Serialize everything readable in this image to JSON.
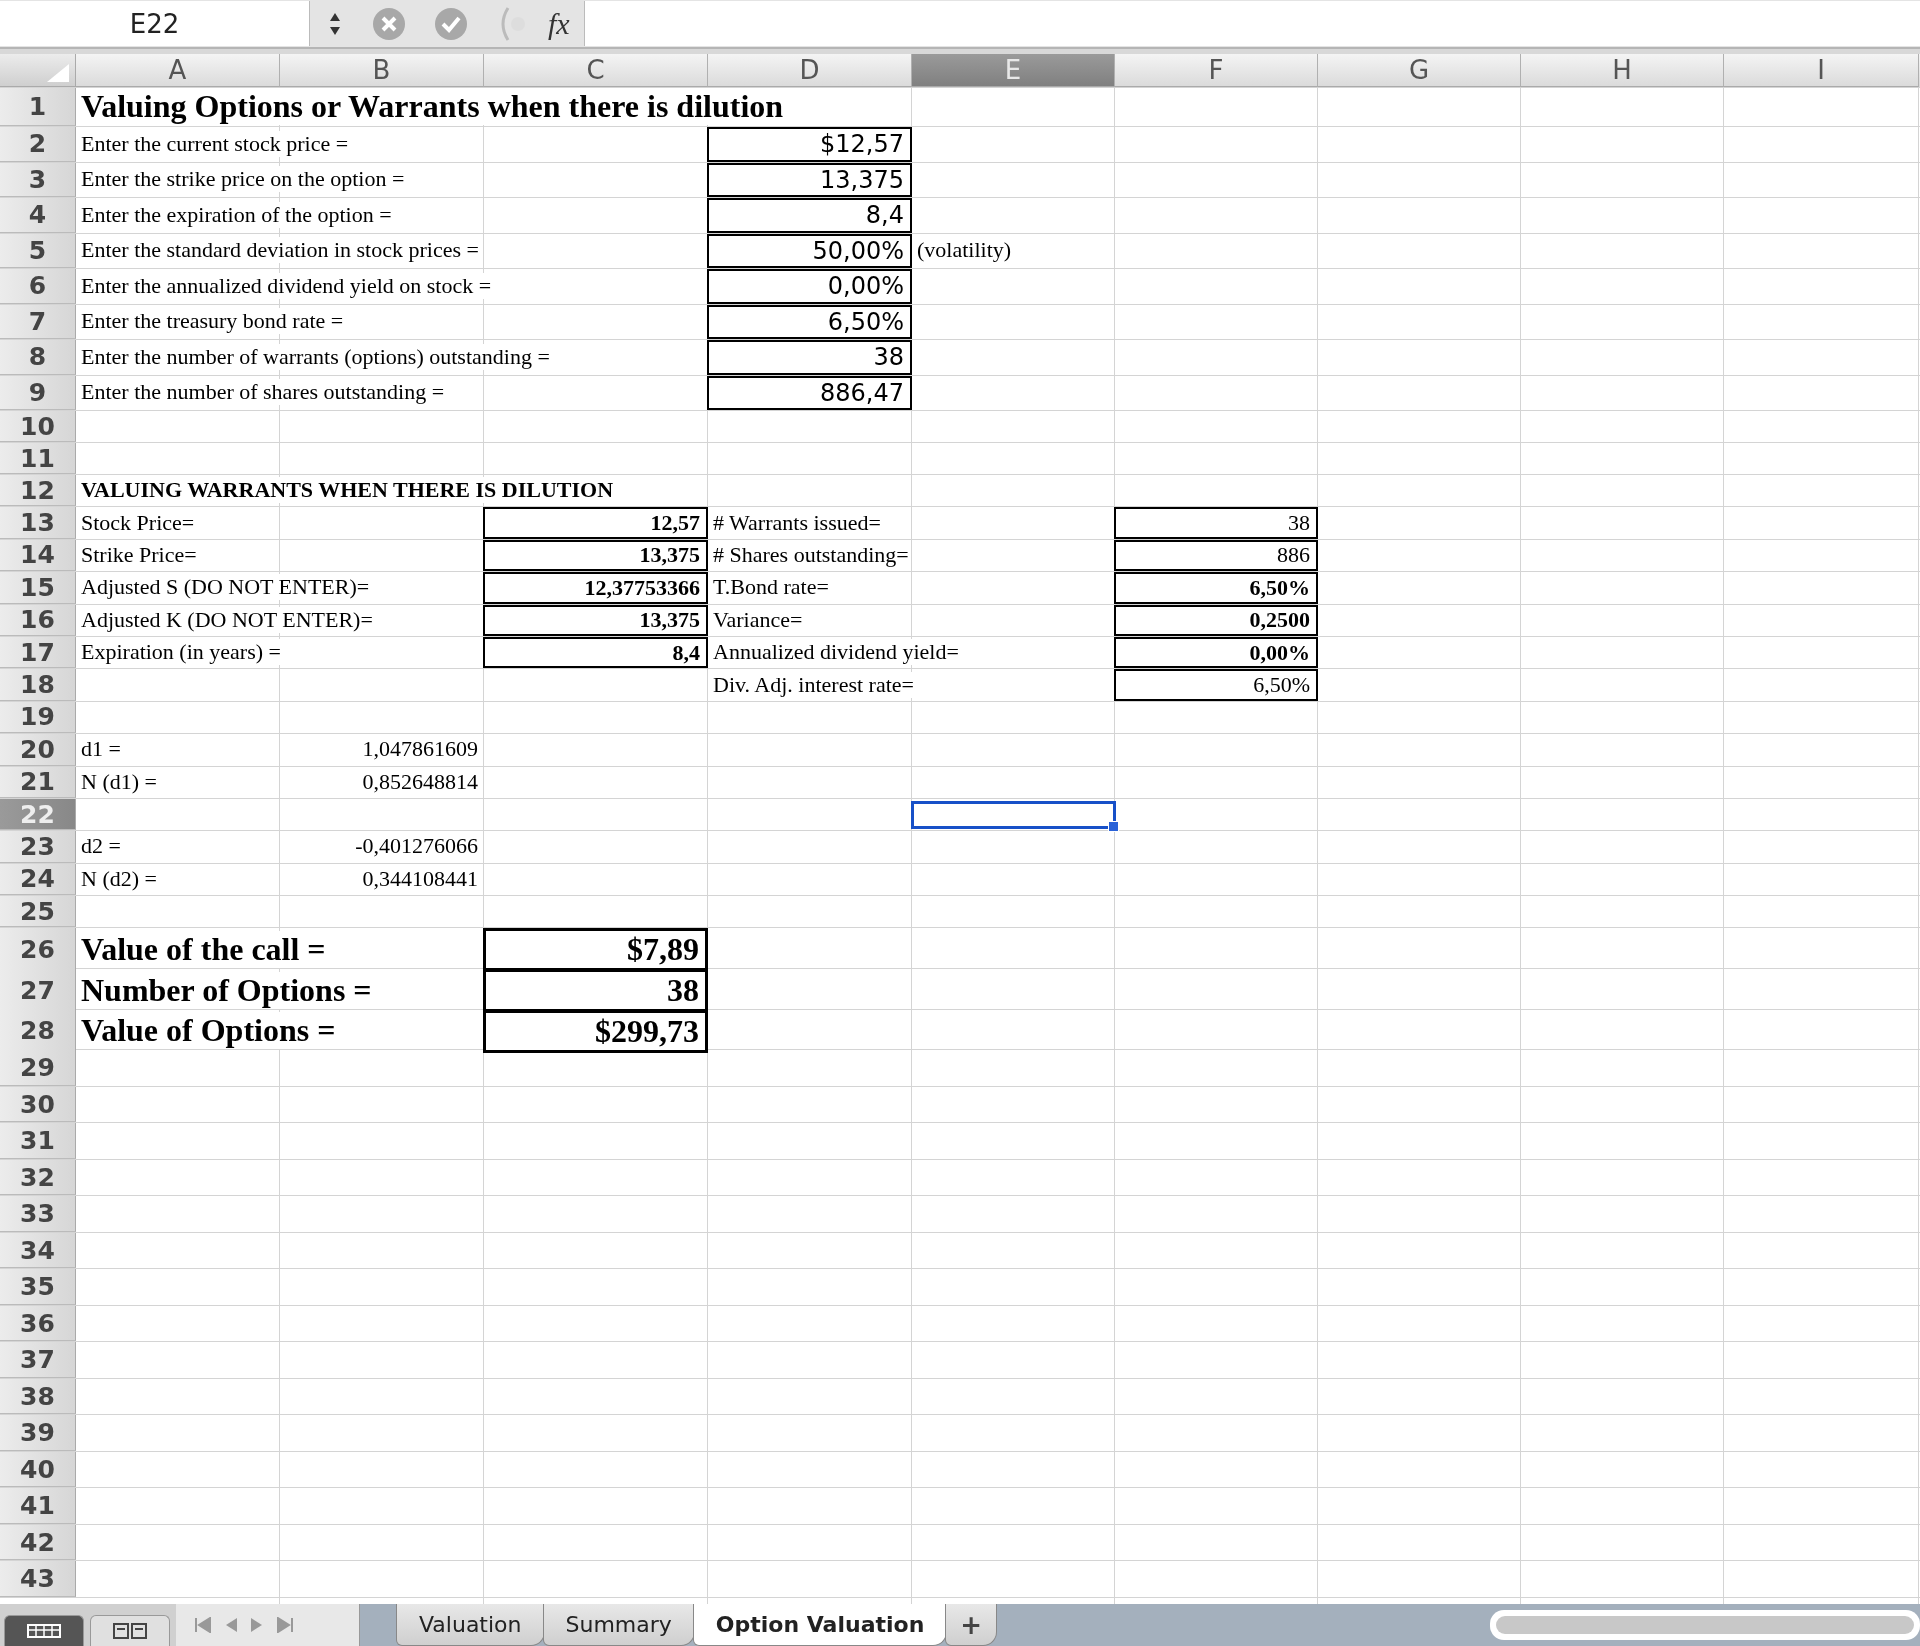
{
  "formula_bar": {
    "cell_ref": "E22",
    "function_label": "fx"
  },
  "columns": [
    {
      "label": "A",
      "selected": false
    },
    {
      "label": "B",
      "selected": false
    },
    {
      "label": "C",
      "selected": false
    },
    {
      "label": "D",
      "selected": false
    },
    {
      "label": "E",
      "selected": true
    },
    {
      "label": "F",
      "selected": false
    },
    {
      "label": "G",
      "selected": false
    },
    {
      "label": "H",
      "selected": false
    },
    {
      "label": "I",
      "selected": false
    }
  ],
  "rows": [
    {
      "number": "1",
      "selected": false,
      "cells": {
        "A": {
          "kind": "title",
          "text": "Valuing Options or Warrants when there is dilution"
        }
      }
    },
    {
      "number": "2",
      "selected": false,
      "cells": {
        "A": {
          "kind": "label",
          "text": "Enter the current stock price ="
        },
        "D": {
          "kind": "input",
          "boxed": true,
          "text": "$12,57"
        }
      }
    },
    {
      "number": "3",
      "selected": false,
      "cells": {
        "A": {
          "kind": "label",
          "text": "Enter the strike price on the option ="
        },
        "D": {
          "kind": "input",
          "boxed": true,
          "text": "13,375"
        }
      }
    },
    {
      "number": "4",
      "selected": false,
      "cells": {
        "A": {
          "kind": "label",
          "text": "Enter the expiration of the option ="
        },
        "D": {
          "kind": "input",
          "boxed": true,
          "text": "8,4"
        }
      }
    },
    {
      "number": "5",
      "selected": false,
      "cells": {
        "A": {
          "kind": "label",
          "text": "Enter the standard deviation in stock prices ="
        },
        "D": {
          "kind": "input",
          "boxed": true,
          "text": "50,00%"
        },
        "E": {
          "kind": "label",
          "text": "(volatility)"
        }
      }
    },
    {
      "number": "6",
      "selected": false,
      "cells": {
        "A": {
          "kind": "label",
          "text": "Enter the annualized dividend yield on stock ="
        },
        "D": {
          "kind": "input",
          "boxed": true,
          "text": "0,00%"
        }
      }
    },
    {
      "number": "7",
      "selected": false,
      "cells": {
        "A": {
          "kind": "label",
          "text": "Enter the treasury bond rate ="
        },
        "D": {
          "kind": "input",
          "boxed": true,
          "text": "6,50%"
        }
      }
    },
    {
      "number": "8",
      "selected": false,
      "cells": {
        "A": {
          "kind": "label",
          "text": "Enter the number of warrants (options) outstanding ="
        },
        "D": {
          "kind": "input",
          "boxed": true,
          "text": "38"
        }
      }
    },
    {
      "number": "9",
      "selected": false,
      "cells": {
        "A": {
          "kind": "label",
          "text": "Enter the number of shares outstanding ="
        },
        "D": {
          "kind": "input",
          "boxed": true,
          "text": "886,47"
        }
      }
    },
    {
      "number": "10",
      "selected": false
    },
    {
      "number": "11",
      "selected": false
    },
    {
      "number": "12",
      "selected": false,
      "cells": {
        "A": {
          "kind": "section",
          "text": "VALUING WARRANTS WHEN THERE IS DILUTION"
        }
      }
    },
    {
      "number": "13",
      "selected": false,
      "cells": {
        "A": {
          "kind": "label",
          "text": "Stock Price="
        },
        "C": {
          "kind": "value-bold",
          "boxed": true,
          "text": "12,57"
        },
        "D": {
          "kind": "label",
          "text": "# Warrants issued="
        },
        "F": {
          "kind": "value",
          "boxed": true,
          "text": "38"
        }
      }
    },
    {
      "number": "14",
      "selected": false,
      "cells": {
        "A": {
          "kind": "label",
          "text": "Strike Price="
        },
        "C": {
          "kind": "value-bold",
          "boxed": true,
          "text": "13,375"
        },
        "D": {
          "kind": "label",
          "text": "# Shares outstanding="
        },
        "F": {
          "kind": "value",
          "boxed": true,
          "text": "886"
        }
      }
    },
    {
      "number": "15",
      "selected": false,
      "cells": {
        "A": {
          "kind": "label",
          "text": "Adjusted S (DO NOT ENTER)="
        },
        "C": {
          "kind": "value-bold",
          "boxed": true,
          "text": "12,37753366"
        },
        "D": {
          "kind": "label",
          "text": "T.Bond rate="
        },
        "F": {
          "kind": "value-bold",
          "boxed": true,
          "text": "6,50%"
        }
      }
    },
    {
      "number": "16",
      "selected": false,
      "cells": {
        "A": {
          "kind": "label",
          "text": "Adjusted K (DO NOT ENTER)="
        },
        "C": {
          "kind": "value-bold",
          "boxed": true,
          "text": "13,375"
        },
        "D": {
          "kind": "label",
          "text": "Variance="
        },
        "F": {
          "kind": "value-bold",
          "boxed": true,
          "text": "0,2500"
        }
      }
    },
    {
      "number": "17",
      "selected": false,
      "cells": {
        "A": {
          "kind": "label",
          "text": "Expiration (in years) ="
        },
        "C": {
          "kind": "value-bold",
          "boxed": true,
          "text": "8,4"
        },
        "D": {
          "kind": "label",
          "text": "Annualized dividend yield="
        },
        "F": {
          "kind": "value-bold",
          "boxed": true,
          "text": "0,00%"
        }
      }
    },
    {
      "number": "18",
      "selected": false,
      "cells": {
        "D": {
          "kind": "label",
          "text": "Div. Adj. interest rate="
        },
        "F": {
          "kind": "value",
          "boxed": true,
          "text": "6,50%"
        }
      }
    },
    {
      "number": "19",
      "selected": false
    },
    {
      "number": "20",
      "selected": false,
      "cells": {
        "A": {
          "kind": "label",
          "text": "d1 ="
        },
        "B": {
          "kind": "value",
          "text": "1,047861609"
        }
      }
    },
    {
      "number": "21",
      "selected": false,
      "cells": {
        "A": {
          "kind": "label",
          "text": "N (d1) ="
        },
        "B": {
          "kind": "value",
          "text": "0,852648814"
        }
      }
    },
    {
      "number": "22",
      "selected": true
    },
    {
      "number": "23",
      "selected": false,
      "cells": {
        "A": {
          "kind": "label",
          "text": "d2 ="
        },
        "B": {
          "kind": "value",
          "text": "-0,401276066"
        }
      }
    },
    {
      "number": "24",
      "selected": false,
      "cells": {
        "A": {
          "kind": "label",
          "text": "N (d2) ="
        },
        "B": {
          "kind": "value",
          "text": "0,344108441"
        }
      }
    },
    {
      "number": "25",
      "selected": false
    },
    {
      "number": "26",
      "selected": false,
      "cells": {
        "A": {
          "kind": "big-label",
          "text": "Value of the call ="
        },
        "C": {
          "kind": "big-value",
          "boxed": true,
          "text": "$7,89"
        }
      }
    },
    {
      "number": "27",
      "selected": false,
      "cells": {
        "A": {
          "kind": "big-label",
          "text": "Number of Options ="
        },
        "C": {
          "kind": "big-value",
          "boxed": true,
          "text": "38"
        }
      }
    },
    {
      "number": "28",
      "selected": false,
      "cells": {
        "A": {
          "kind": "big-label",
          "text": "Value of Options ="
        },
        "C": {
          "kind": "big-value",
          "boxed": true,
          "text": "$299,73"
        }
      }
    },
    {
      "number": "29",
      "selected": false
    },
    {
      "number": "30",
      "selected": false
    },
    {
      "number": "31",
      "selected": false
    },
    {
      "number": "32",
      "selected": false
    },
    {
      "number": "33",
      "selected": false
    },
    {
      "number": "34",
      "selected": false
    },
    {
      "number": "35",
      "selected": false
    },
    {
      "number": "36",
      "selected": false
    },
    {
      "number": "37",
      "selected": false
    },
    {
      "number": "38",
      "selected": false
    },
    {
      "number": "39",
      "selected": false
    },
    {
      "number": "40",
      "selected": false
    },
    {
      "number": "41",
      "selected": false
    },
    {
      "number": "42",
      "selected": false
    },
    {
      "number": "43",
      "selected": false
    }
  ],
  "view_buttons": [
    {
      "selected": true,
      "kind": "normal"
    },
    {
      "selected": false,
      "kind": "layout"
    }
  ],
  "sheet_tabs": [
    {
      "label": "Valuation",
      "selected": false
    },
    {
      "label": "Summary",
      "selected": false
    },
    {
      "label": "Option Valuation",
      "selected": true
    }
  ],
  "add_sheet": "+"
}
